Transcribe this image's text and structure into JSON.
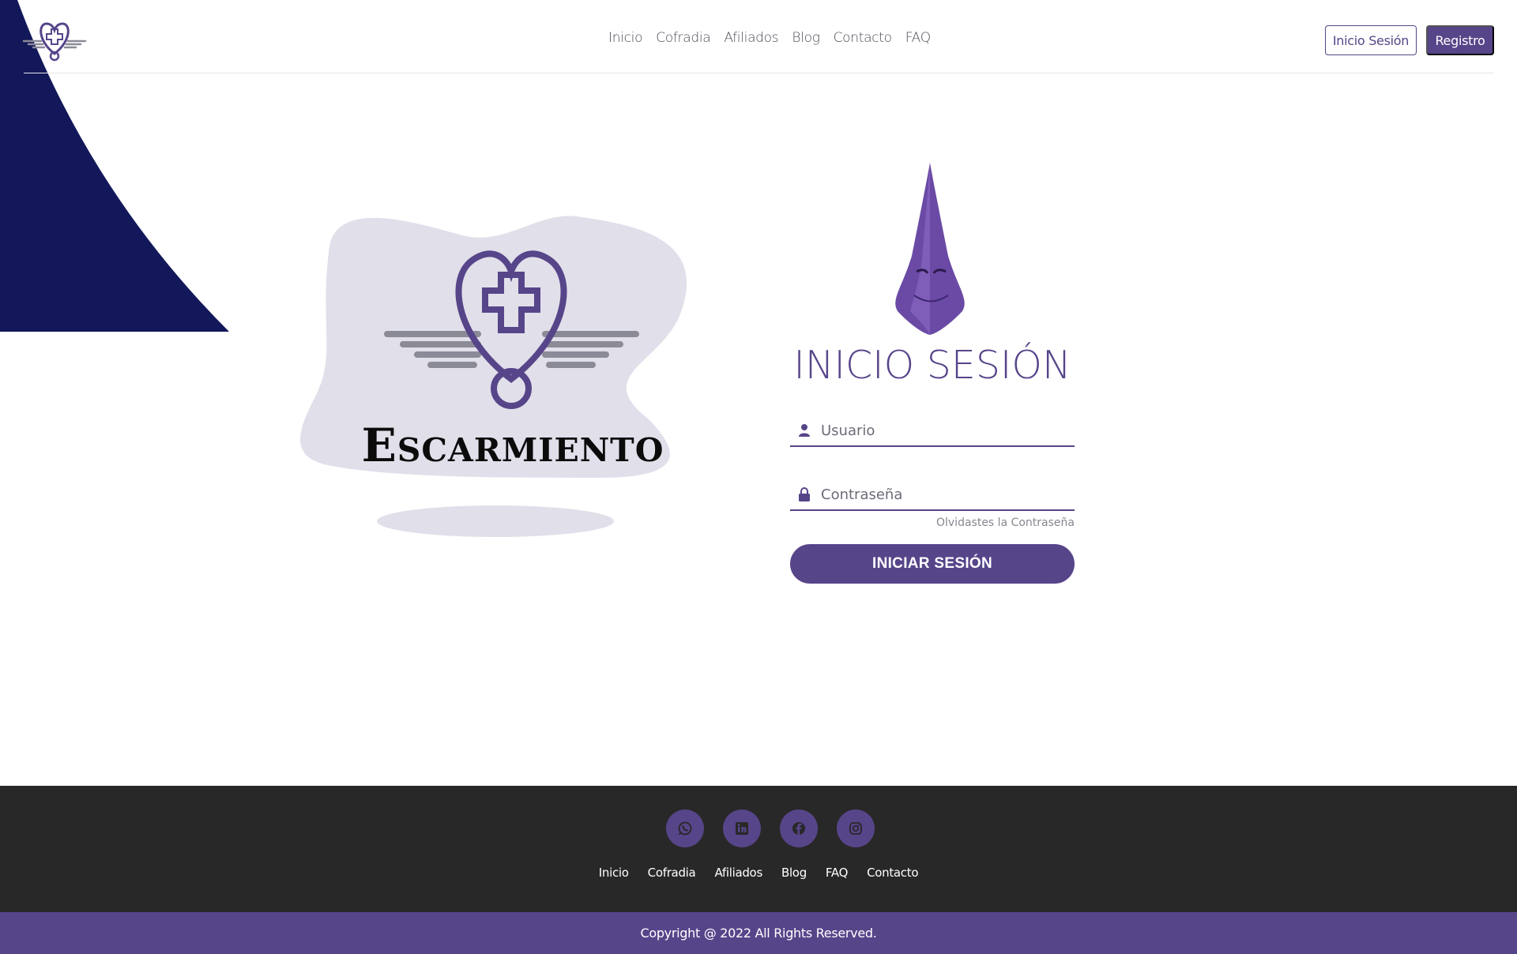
{
  "header": {
    "nav": [
      "Inicio",
      "Cofradia",
      "Afiliados",
      "Blog",
      "Contacto",
      "FAQ"
    ],
    "login_label": "Inicio Sesión",
    "register_label": "Registro"
  },
  "hero": {
    "brand_name": "Escarmiento"
  },
  "login": {
    "title": "INICIO SESIÓN",
    "username_placeholder": "Usuario",
    "password_placeholder": "Contraseña",
    "forgot_label": "Olvidastes la Contraseña",
    "submit_label": "INICIAR SESIÓN"
  },
  "footer": {
    "social": [
      "whatsapp-icon",
      "linkedin-icon",
      "facebook-icon",
      "instagram-icon"
    ],
    "nav": [
      "Inicio",
      "Cofradia",
      "Afiliados",
      "Blog",
      "FAQ",
      "Contacto"
    ],
    "copyright": "Copyright @ 2022 All Rights Reserved."
  },
  "colors": {
    "brand": "#57458a",
    "corner": "#13185a",
    "footer_bg": "#282828",
    "blob": "#e1dfe9"
  }
}
